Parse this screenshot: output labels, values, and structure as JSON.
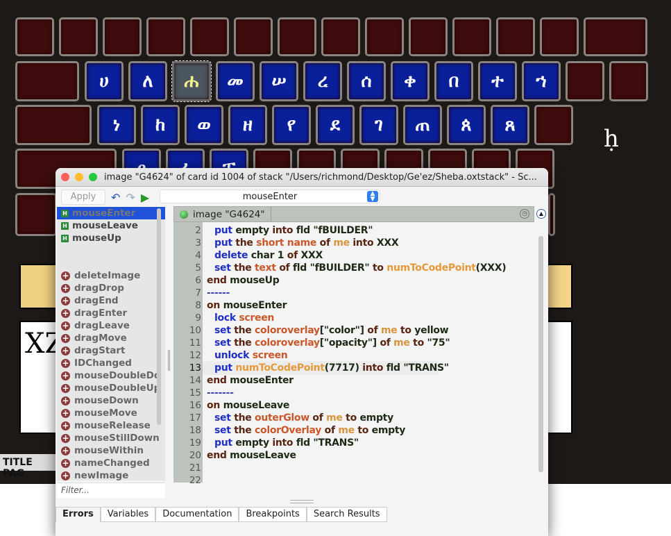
{
  "card": {
    "row2": [
      "ሀ",
      "ለ",
      "ሐ",
      "መ",
      "ሠ",
      "ረ",
      "ሰ",
      "ቀ",
      "በ",
      "ተ",
      "ኀ"
    ],
    "row3": [
      "ነ",
      "ከ",
      "ወ",
      "ዘ",
      "የ",
      "ደ",
      "ገ",
      "ጠ",
      "ጰ",
      "ጸ"
    ],
    "row4": [
      "ፀ",
      "ፈ",
      "ፐ"
    ],
    "selected_key": "ሐ",
    "display_text": "XZ",
    "title_page_button": "TITLE PAG",
    "trans_field": "ḥ",
    "colors": {
      "key_blue": "#0a1f9a",
      "key_brown": "#3e0c0c",
      "band": "#f0d082",
      "highlight_letter": "#f6f08a"
    }
  },
  "window": {
    "title": "image \"G4624\" of card id 1004 of stack \"/Users/richmond/Desktop/Ge'ez/Sheba.oxtstack\" - Sc...",
    "toolbar": {
      "apply": "Apply",
      "handler_select": "mouseEnter"
    },
    "handlers": [
      {
        "label": "mouseEnter",
        "type": "defined",
        "selected": true
      },
      {
        "label": "mouseLeave",
        "type": "defined"
      },
      {
        "label": "mouseUp",
        "type": "defined"
      }
    ],
    "available": [
      "deleteImage",
      "dragDrop",
      "dragEnd",
      "dragEnter",
      "dragLeave",
      "dragMove",
      "dragStart",
      "IDChanged",
      "mouseDoubleDo",
      "mouseDoubleUp",
      "mouseDown",
      "mouseMove",
      "mouseRelease",
      "mouseStillDown",
      "mouseWithin",
      "nameChanged",
      "newImage"
    ],
    "filter_placeholder": "Filter...",
    "editor_tab": "image \"G4624\"",
    "current_line": 13,
    "code": [
      {
        "n": "2",
        "t": [
          [
            "kw",
            "put"
          ],
          [
            "tx",
            " empty "
          ],
          [
            "ctl",
            "into"
          ],
          [
            "tx",
            " fld \"fBUILDER\""
          ]
        ],
        "i": 1
      },
      {
        "n": "3",
        "t": [
          [
            "kw",
            "put"
          ],
          [
            "ctl",
            " the "
          ],
          [
            "prop",
            "short name"
          ],
          [
            "ctl",
            " of "
          ],
          [
            "me",
            "me"
          ],
          [
            "ctl",
            " into"
          ],
          [
            "tx",
            " XXX"
          ]
        ],
        "i": 1
      },
      {
        "n": "4",
        "t": [
          [
            "kw",
            "delete"
          ],
          [
            "tx",
            " char 1 "
          ],
          [
            "ctl",
            "of"
          ],
          [
            "tx",
            " XXX"
          ]
        ],
        "i": 1
      },
      {
        "n": "5",
        "t": [
          [
            "kw",
            "set"
          ],
          [
            "ctl",
            " the "
          ],
          [
            "prop",
            "text"
          ],
          [
            "ctl",
            " of"
          ],
          [
            "tx",
            " fld \"fBUILDER\" "
          ],
          [
            "ctl",
            "to "
          ],
          [
            "fn",
            "numToCodePoint"
          ],
          [
            "tx",
            "(XXX)"
          ]
        ],
        "i": 1
      },
      {
        "n": "6",
        "t": [
          [
            "ctl",
            "end"
          ],
          [
            "tx",
            " mouseUp"
          ]
        ],
        "i": 0
      },
      {
        "n": "7",
        "t": [
          [
            "cm",
            "------"
          ]
        ],
        "i": 0
      },
      {
        "n": "8",
        "t": [
          [
            "ctl",
            "on"
          ],
          [
            "tx",
            " mouseEnter"
          ]
        ],
        "i": 0
      },
      {
        "n": "9",
        "t": [
          [
            "kw",
            "lock"
          ],
          [
            "prop",
            " screen"
          ]
        ],
        "i": 1
      },
      {
        "n": "10",
        "t": [
          [
            "kw",
            "set"
          ],
          [
            "ctl",
            " the "
          ],
          [
            "prop",
            "coloroverlay"
          ],
          [
            "tx",
            "[\"color\"] "
          ],
          [
            "ctl",
            "of "
          ],
          [
            "me",
            "me"
          ],
          [
            "ctl",
            " to"
          ],
          [
            "tx",
            " yellow"
          ]
        ],
        "i": 1
      },
      {
        "n": "11",
        "t": [
          [
            "kw",
            "set"
          ],
          [
            "ctl",
            " the "
          ],
          [
            "prop",
            "coloroverlay"
          ],
          [
            "tx",
            "[\"opacity\"] "
          ],
          [
            "ctl",
            "of "
          ],
          [
            "me",
            "me"
          ],
          [
            "ctl",
            " to"
          ],
          [
            "tx",
            " \"75\""
          ]
        ],
        "i": 1
      },
      {
        "n": "12",
        "t": [
          [
            "kw",
            "unlock"
          ],
          [
            "prop",
            " screen"
          ]
        ],
        "i": 1
      },
      {
        "n": "13",
        "t": [
          [
            "kw",
            "put"
          ],
          [
            "fn",
            " numToCodePoint"
          ],
          [
            "tx",
            "(7717) "
          ],
          [
            "ctl",
            "into"
          ],
          [
            "tx",
            " fld \"TRANS\""
          ]
        ],
        "i": 1
      },
      {
        "n": "14",
        "t": [
          [
            "ctl",
            "end"
          ],
          [
            "tx",
            " mouseEnter"
          ]
        ],
        "i": 0
      },
      {
        "n": "15",
        "t": [
          [
            "cm",
            "-------"
          ]
        ],
        "i": 0
      },
      {
        "n": "16",
        "t": [
          [
            "ctl",
            "on"
          ],
          [
            "tx",
            " mouseLeave"
          ]
        ],
        "i": 0
      },
      {
        "n": "17",
        "t": [
          [
            "kw",
            "set"
          ],
          [
            "ctl",
            " the "
          ],
          [
            "prop",
            "outerGlow"
          ],
          [
            "ctl",
            " of "
          ],
          [
            "me",
            "me"
          ],
          [
            "ctl",
            " to"
          ],
          [
            "tx",
            " empty"
          ]
        ],
        "i": 1
      },
      {
        "n": "18",
        "t": [
          [
            "kw",
            "set"
          ],
          [
            "ctl",
            " the "
          ],
          [
            "prop",
            "colorOverlay"
          ],
          [
            "ctl",
            " of "
          ],
          [
            "me",
            "me"
          ],
          [
            "ctl",
            " to"
          ],
          [
            "tx",
            " empty"
          ]
        ],
        "i": 1
      },
      {
        "n": "19",
        "t": [
          [
            "kw",
            "put"
          ],
          [
            "tx",
            " empty "
          ],
          [
            "ctl",
            "into"
          ],
          [
            "tx",
            " fld \"TRANS\""
          ]
        ],
        "i": 1
      },
      {
        "n": "20",
        "t": [
          [
            "ctl",
            "end"
          ],
          [
            "tx",
            " mouseLeave"
          ]
        ],
        "i": 0
      },
      {
        "n": "21",
        "t": [],
        "i": 0
      },
      {
        "n": "22",
        "t": [],
        "i": 0
      }
    ],
    "bottom_tabs": [
      "Errors",
      "Variables",
      "Documentation",
      "Breakpoints",
      "Search Results"
    ],
    "active_bottom_tab": "Errors"
  }
}
